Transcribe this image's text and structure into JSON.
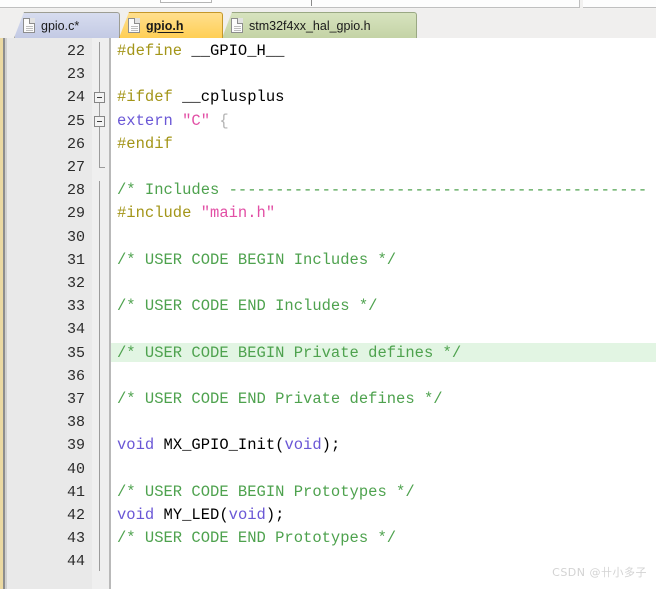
{
  "toolbar": {
    "visible_fragment": true
  },
  "tabs": [
    {
      "label": "gpio.c*",
      "state": "modified",
      "color": "#c3cae4",
      "icon": "file-icon",
      "active": false
    },
    {
      "label": "gpio.h",
      "state": "active",
      "color": "#ffcf55",
      "icon": "file-icon",
      "active": true
    },
    {
      "label": "stm32f4xx_hal_gpio.h",
      "state": "inactive",
      "color": "#c4d3a6",
      "icon": "file-icon",
      "active": false
    }
  ],
  "editor": {
    "language": "c-header",
    "highlighted_line": 35,
    "first_line": 22,
    "last_line": 44,
    "colors": {
      "preprocessor": "#a39518",
      "keyword": "#6a57d6",
      "string": "#e24fa5",
      "comment": "#4ea24e",
      "text": "#000000",
      "gutter_bg": "#e9e9e9",
      "current_line_bg": "#e2f5e3"
    },
    "line_numbers": [
      22,
      23,
      24,
      25,
      26,
      27,
      28,
      29,
      30,
      31,
      32,
      33,
      34,
      35,
      36,
      37,
      38,
      39,
      40,
      41,
      42,
      43,
      44
    ],
    "fold_markers": [
      {
        "line": 24,
        "type": "collapse-box"
      },
      {
        "line": 25,
        "type": "collapse-box"
      },
      {
        "line": 27,
        "type": "fold-end-tick"
      }
    ],
    "lines": [
      {
        "n": 22,
        "tokens": [
          {
            "t": "#define ",
            "c": "pre"
          },
          {
            "t": "__GPIO_H__",
            "c": "plain"
          }
        ]
      },
      {
        "n": 23,
        "tokens": []
      },
      {
        "n": 24,
        "tokens": [
          {
            "t": "#ifdef ",
            "c": "pre"
          },
          {
            "t": "__cplusplus",
            "c": "plain"
          }
        ]
      },
      {
        "n": 25,
        "tokens": [
          {
            "t": "extern ",
            "c": "kw"
          },
          {
            "t": "\"C\"",
            "c": "str"
          },
          {
            "t": " {",
            "c": "brace"
          }
        ]
      },
      {
        "n": 26,
        "tokens": [
          {
            "t": "#endif",
            "c": "pre"
          }
        ]
      },
      {
        "n": 27,
        "tokens": []
      },
      {
        "n": 28,
        "tokens": [
          {
            "t": "/* Includes ---------------------------------------------",
            "c": "cmt"
          }
        ]
      },
      {
        "n": 29,
        "tokens": [
          {
            "t": "#include ",
            "c": "pre"
          },
          {
            "t": "\"main.h\"",
            "c": "str"
          }
        ]
      },
      {
        "n": 30,
        "tokens": []
      },
      {
        "n": 31,
        "tokens": [
          {
            "t": "/* USER CODE BEGIN Includes */",
            "c": "cmt"
          }
        ]
      },
      {
        "n": 32,
        "tokens": []
      },
      {
        "n": 33,
        "tokens": [
          {
            "t": "/* USER CODE END Includes */",
            "c": "cmt"
          }
        ]
      },
      {
        "n": 34,
        "tokens": []
      },
      {
        "n": 35,
        "tokens": [
          {
            "t": "/* USER CODE BEGIN Private defines */",
            "c": "cmt"
          }
        ]
      },
      {
        "n": 36,
        "tokens": []
      },
      {
        "n": 37,
        "tokens": [
          {
            "t": "/* USER CODE END Private defines */",
            "c": "cmt"
          }
        ]
      },
      {
        "n": 38,
        "tokens": []
      },
      {
        "n": 39,
        "tokens": [
          {
            "t": "void ",
            "c": "kw"
          },
          {
            "t": "MX_GPIO_Init",
            "c": "plain"
          },
          {
            "t": "(",
            "c": "punc"
          },
          {
            "t": "void",
            "c": "kw"
          },
          {
            "t": ");",
            "c": "punc"
          }
        ]
      },
      {
        "n": 40,
        "tokens": []
      },
      {
        "n": 41,
        "tokens": [
          {
            "t": "/* USER CODE BEGIN Prototypes */",
            "c": "cmt"
          }
        ]
      },
      {
        "n": 42,
        "tokens": [
          {
            "t": "void ",
            "c": "kw"
          },
          {
            "t": "MY_LED",
            "c": "plain"
          },
          {
            "t": "(",
            "c": "punc"
          },
          {
            "t": "void",
            "c": "kw"
          },
          {
            "t": ");",
            "c": "punc"
          }
        ]
      },
      {
        "n": 43,
        "tokens": [
          {
            "t": "/* USER CODE END Prototypes */",
            "c": "cmt"
          }
        ]
      },
      {
        "n": 44,
        "tokens": []
      }
    ]
  },
  "watermark": {
    "text": "CSDN @卄小多子"
  }
}
